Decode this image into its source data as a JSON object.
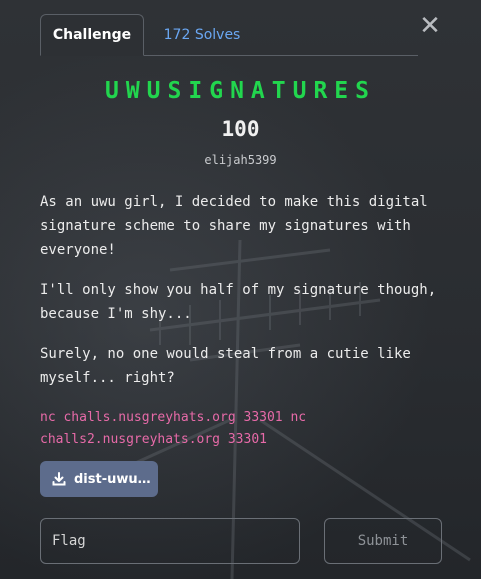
{
  "tabs": [
    {
      "label": "Challenge",
      "active": true
    },
    {
      "label": "172 Solves",
      "active": false
    }
  ],
  "close_icon": "close-icon",
  "challenge": {
    "title": "UWUSIGNATURES",
    "points": "100",
    "author": "elijah5399",
    "description": [
      "As an uwu girl, I decided to make this digital signature scheme to share my signatures with everyone!",
      "I'll only show you half of my signature though, because I'm shy...",
      "Surely, no one would steal from a cutie like myself... right?"
    ],
    "connection": "nc challs.nusgreyhats.org 33301 nc challs2.nusgreyhats.org 33301"
  },
  "download": {
    "label": "dist-uwu…",
    "icon": "download-icon"
  },
  "flag_input": {
    "placeholder": "Flag",
    "value": ""
  },
  "submit_label": "Submit",
  "colors": {
    "title": "#22d64e",
    "solves_tab": "#6aa7f2",
    "connection_text": "#e76aa8",
    "download_button": "#5d6c8c",
    "background": "#2b2e32"
  }
}
